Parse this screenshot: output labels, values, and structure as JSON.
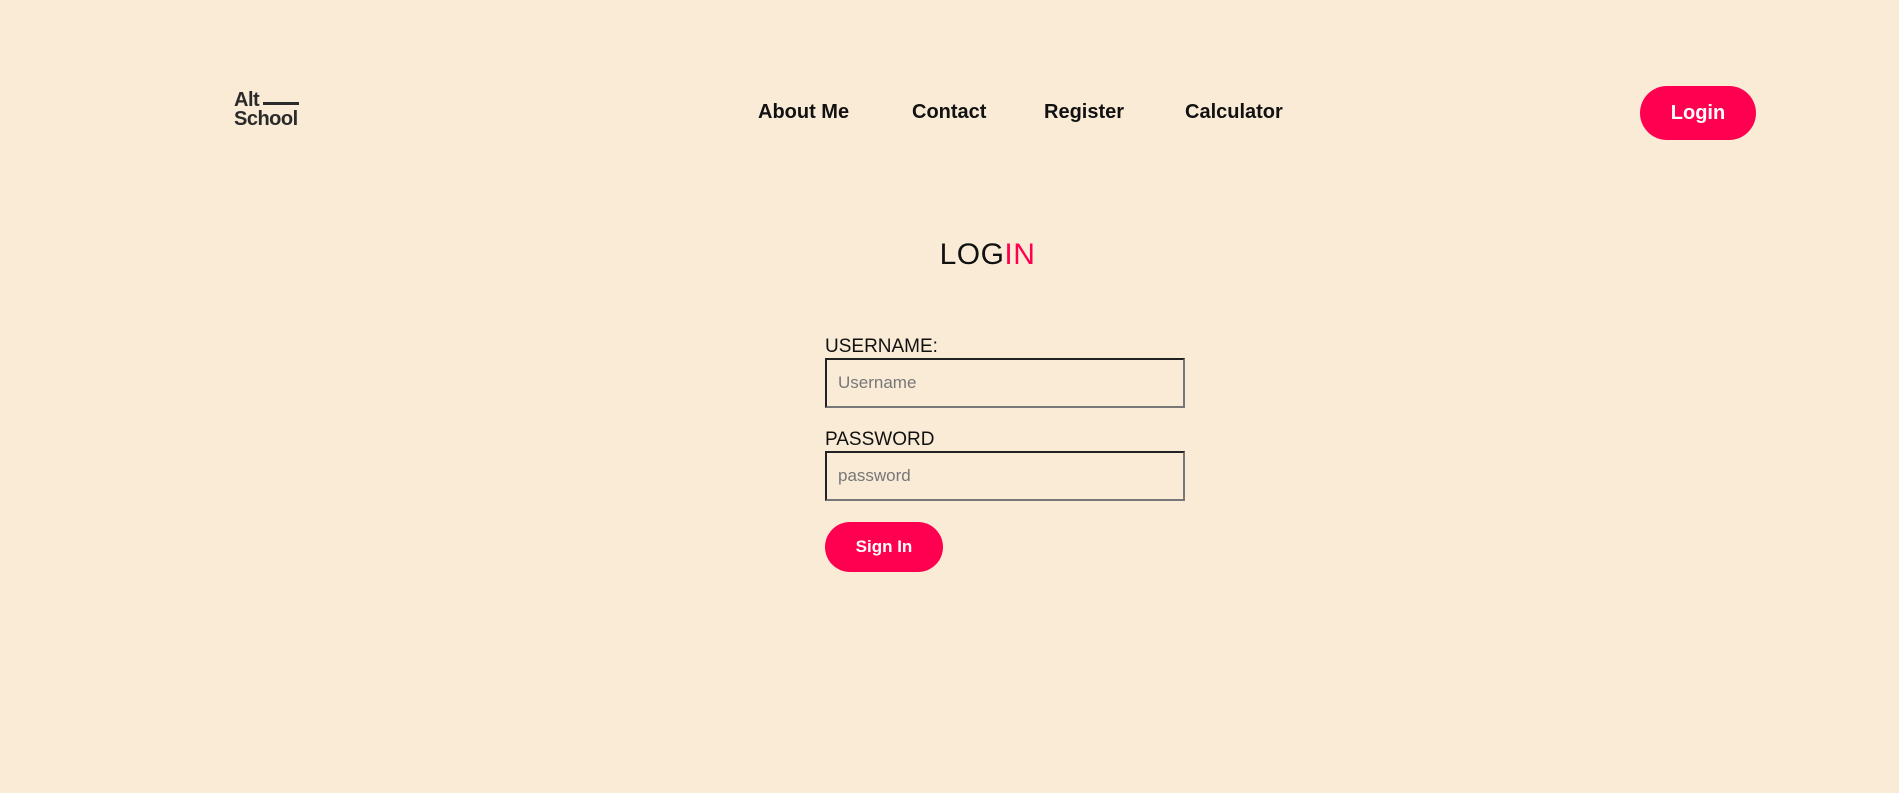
{
  "logo": {
    "line1": "Alt",
    "line2": "School"
  },
  "nav": {
    "items": [
      {
        "label": "About Me"
      },
      {
        "label": "Contact"
      },
      {
        "label": "Register"
      },
      {
        "label": "Calculator"
      }
    ],
    "login_label": "Login"
  },
  "page": {
    "title_part1": "LOG",
    "title_part2": "IN"
  },
  "form": {
    "username_label": "USERNAME:",
    "username_placeholder": "Username",
    "password_label": "PASSWORD",
    "password_placeholder": "password",
    "submit_label": "Sign In"
  },
  "colors": {
    "background": "#FAEBD7",
    "accent": "#FF0050",
    "text": "#111111"
  }
}
